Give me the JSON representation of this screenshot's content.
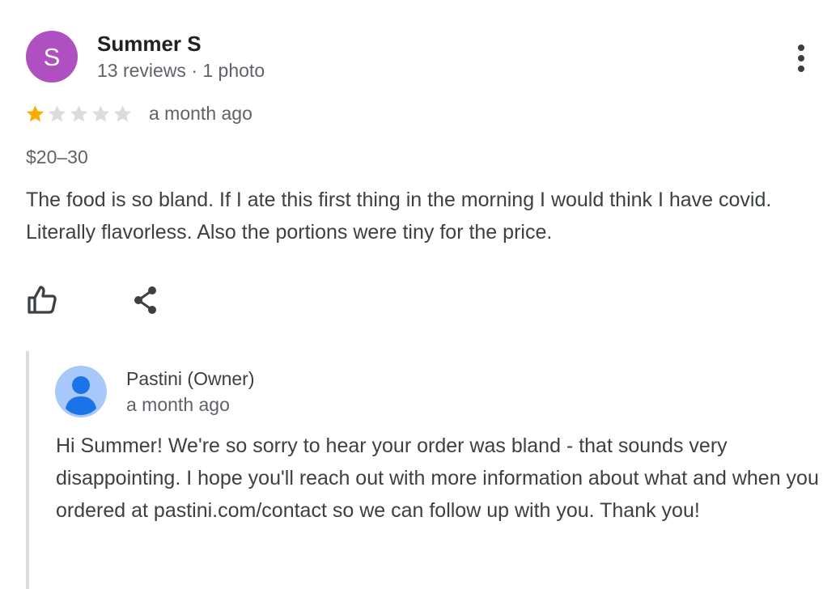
{
  "review": {
    "reviewer": {
      "initial": "S",
      "name": "Summer S",
      "meta": "13 reviews · 1 photo",
      "avatar_color": "#b04fc2"
    },
    "more_icon": "more-vertical-icon",
    "rating": {
      "value": 1,
      "max": 5,
      "filled_color": "#f9ab00",
      "empty_color": "#dadce0"
    },
    "date": "a month ago",
    "price": "$20–30",
    "text": "The food is so bland. If I ate this first thing in the morning I would think I have covid. Literally flavorless. Also the portions were tiny for the price.",
    "actions": {
      "like_icon": "thumbs-up-icon",
      "share_icon": "share-icon"
    }
  },
  "owner_reply": {
    "name": "Pastini (Owner)",
    "date": "a month ago",
    "avatar_icon": "default-profile-icon",
    "text": "Hi Summer! We're so sorry to hear your order was bland - that sounds very disappointing. I hope you'll reach out with more information about what and when you ordered at pastini.com/contact so we can follow up with you. Thank you!"
  }
}
